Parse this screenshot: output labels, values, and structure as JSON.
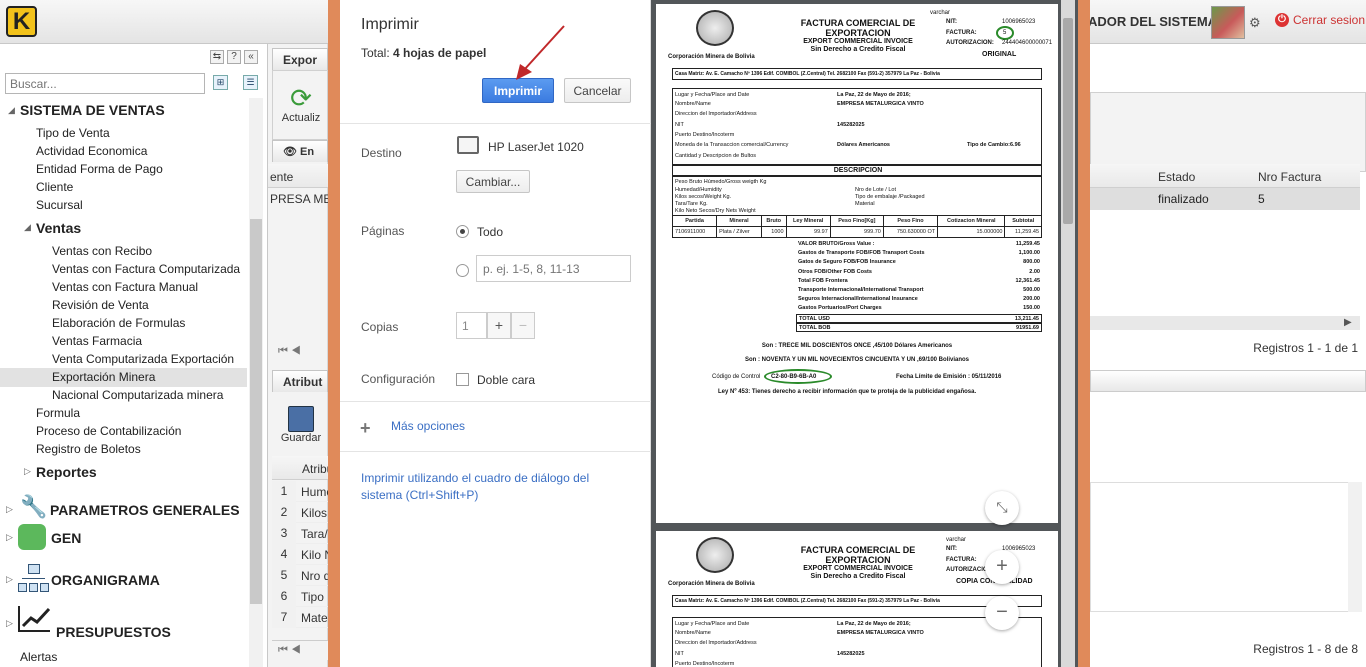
{
  "app": {
    "logo_letter": "K",
    "system_title": "ADOR DEL SISTEMA",
    "logout_label": "Cerrar sesion"
  },
  "sidebar": {
    "search_placeholder": "Buscar...",
    "items": [
      {
        "label": "SISTEMA DE VENTAS",
        "level": "root"
      },
      {
        "label": "Tipo de Venta"
      },
      {
        "label": "Actividad Economica"
      },
      {
        "label": "Entidad Forma de Pago"
      },
      {
        "label": "Cliente"
      },
      {
        "label": "Sucursal"
      },
      {
        "label": "Ventas",
        "level": "group"
      },
      {
        "label": "Ventas con Recibo"
      },
      {
        "label": "Ventas con Factura Computarizada"
      },
      {
        "label": "Ventas con Factura Manual"
      },
      {
        "label": "Revisión de Venta"
      },
      {
        "label": "Elaboración de Formulas"
      },
      {
        "label": "Ventas Farmacia"
      },
      {
        "label": "Venta Computarizada Exportación"
      },
      {
        "label": "Exportación Minera",
        "selected": true
      },
      {
        "label": "Nacional Computarizada minera"
      },
      {
        "label": "Formula"
      },
      {
        "label": "Proceso de Contabilización"
      },
      {
        "label": "Registro de Boletos"
      },
      {
        "label": "Reportes",
        "level": "group"
      },
      {
        "label": "PARAMETROS GENERALES",
        "level": "root"
      },
      {
        "label": "GEN",
        "level": "root"
      },
      {
        "label": "ORGANIGRAMA",
        "level": "root"
      },
      {
        "label": "PRESUPUESTOS",
        "level": "root"
      },
      {
        "label": "Alertas"
      }
    ]
  },
  "main": {
    "tab_top": "Expor",
    "actualizar_label": "Actualiz",
    "en_tab": "En",
    "col_ente": "ente",
    "row_ente": "PRESA ME",
    "col_estado": "Estado",
    "col_nro_factura": "Nro Factura",
    "row_estado": "finalizado",
    "row_nro_factura": "5",
    "registros_top": "Registros 1 - 1 de 1",
    "tab_bottom": "Atribut",
    "guardar_label": "Guardar",
    "col_atrib": "Atribu",
    "rows_bottom": [
      "Hume",
      "Kilos",
      "Tara/",
      "Kilo N",
      "Nro d",
      "Tipo",
      "Mater"
    ],
    "registros_bottom": "Registros 1 - 8 de 8"
  },
  "print": {
    "title": "Imprimir",
    "total_prefix": "Total: ",
    "total_value": "4 hojas de papel",
    "print_button": "Imprimir",
    "cancel_button": "Cancelar",
    "destino_label": "Destino",
    "printer_name": "HP LaserJet 1020",
    "change_button": "Cambiar...",
    "paginas_label": "Páginas",
    "todo_label": "Todo",
    "pages_placeholder": "p. ej. 1-5, 8, 11-13",
    "copias_label": "Copias",
    "copias_value": "1",
    "config_label": "Configuración",
    "doble_cara": "Doble cara",
    "mas_opciones": "Más opciones",
    "system_dialog": "Imprimir utilizando el cuadro de diálogo del sistema (Ctrl+Shift+P)"
  },
  "invoice": {
    "title1": "FACTURA COMERCIAL DE",
    "title2": "EXPORTACION",
    "subtitle1": "EXPORT COMMERCIAL INVOICE",
    "subtitle2": "Sin Derecho a Credito Fiscal",
    "varchar": "varchar",
    "nit_label": "NIT:",
    "nit_value": "1006965023",
    "factura_label": "FACTURA:",
    "factura_value": "5",
    "autorizacion_label": "AUTORIZACION:",
    "autorizacion_value": "244404600000071",
    "original": "ORIGINAL",
    "copia": "COPIA CONTABILIDAD",
    "company": "Corporación Minera de Bolivia",
    "address": "Casa Matriz: Av. E. Camacho Nº 1396 Edif. COMIBOL (Z.Central) Tel. 2682100 Fax (591-2) 357979 La Paz - Bolivia",
    "lugar_label": "Lugar y Fecha/Place and Date",
    "lugar_value": "La Paz, 22 de Mayo de 2016;",
    "nombre_label": "Nombre/Name",
    "nombre_value": "EMPRESA METALURGICA VINTO",
    "direccion_label": "Direccion del Importador/Address",
    "nit2_label": "NIT",
    "nit2_value": "145282025",
    "puerto_label": "Puerto Destino/Incoterm",
    "moneda_label": "Moneda de la Transaccion comercial/Currency",
    "moneda_value": "Dólares Americanos",
    "tipo_cambio": "Tipo de Cambio:6.96",
    "cantidad_label": "Cantidad y Descripcion de Bultos",
    "descripcion": "DESCRIPCION",
    "peso_bruto": "Peso Bruto Húmedo/Gross weigth Kg",
    "humedad": "Humedad/Humidity",
    "kilos_secos": "Kilos secos/Weight Kg.",
    "tara": "Tara/Tare Kg.",
    "kilo_neto": "Kilo Neto Secos/Dry Nets Weight",
    "nro_lote": "Nro de Lote / Lot",
    "tipo_embalaje": "Tipo de embalaje /Packaged",
    "material": "Material",
    "table_headers": [
      "Partida",
      "Mineral",
      "Bruto",
      "Ley Mineral",
      "Peso Fino[Kg]",
      "Peso Fino",
      "Cotizacion Mineral",
      "Subtotal"
    ],
    "table_row": [
      "7106911000",
      "Plata / Zilver",
      "1000",
      "99.97",
      "999.70",
      "750.630000 OT",
      "15.000000",
      "11,259.45"
    ],
    "totals": [
      [
        "VALOR BRUTO/Gross Value :",
        "11,259.45"
      ],
      [
        "Gastos de Transporte FOB/FOB Transport Costs",
        "1,100.00"
      ],
      [
        "Gatos de Seguro FOB/FOB Insurance",
        "800.00"
      ],
      [
        "Otros FOB/Other FOB Costs",
        "2.00"
      ],
      [
        "Total FOB Frontera",
        "12,361.45"
      ],
      [
        "Transporte Internacional/International Transport",
        "500.00"
      ],
      [
        "Seguros Internacional/International Insurance",
        "200.00"
      ],
      [
        "Gastos Portuarios/Port Charges",
        "150.00"
      ],
      [
        "TOTAL USD",
        "13,211.45"
      ],
      [
        "TOTAL BOB",
        "91951.69"
      ]
    ],
    "son_usd": "Son : TRECE MIL DOSCIENTOS ONCE ,45/100 Dólares Americanos",
    "son_bob": "Son : NOVENTA Y UN MIL NOVECIENTOS CINCUENTA Y UN ,69/100 Bolivianos",
    "codigo_label": "Código de Control",
    "codigo_value": "C2-80-B9-6B-A0",
    "fecha_limite": "Fecha Límite de Emisión : 05/11/2016",
    "ley": "Ley Nº 453: Tienes derecho a recibir información que te proteja de la publicidad engañosa."
  }
}
